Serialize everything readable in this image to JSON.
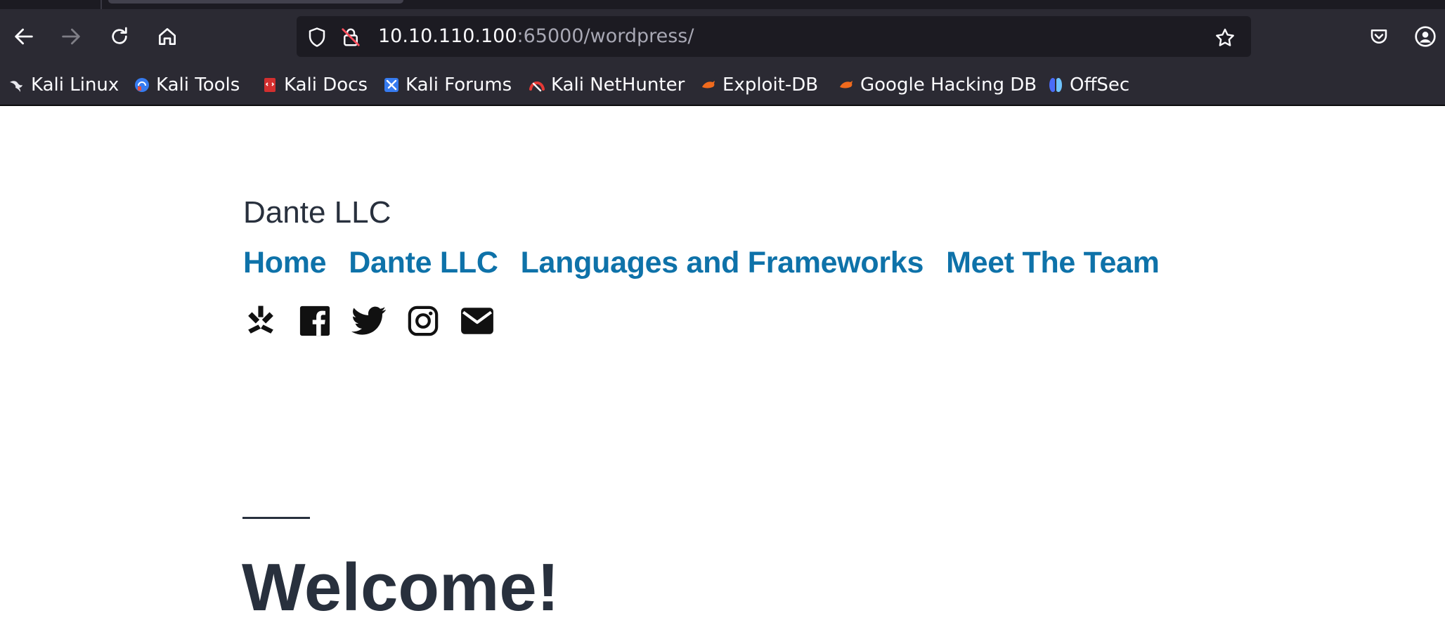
{
  "browser": {
    "url_host": "10.10.110.100",
    "url_rest": ":65000/wordpress/",
    "bookmarks": [
      {
        "label": "Kali Linux",
        "icon": "kali-dragon-icon"
      },
      {
        "label": "Kali Tools",
        "icon": "kali-tools-icon"
      },
      {
        "label": "Kali Docs",
        "icon": "kali-docs-icon"
      },
      {
        "label": "Kali Forums",
        "icon": "kali-forums-icon"
      },
      {
        "label": "Kali NetHunter",
        "icon": "kali-nethunter-icon"
      },
      {
        "label": "Exploit-DB",
        "icon": "exploit-db-icon"
      },
      {
        "label": "Google Hacking DB",
        "icon": "google-hacking-db-icon"
      },
      {
        "label": "OffSec",
        "icon": "offsec-icon"
      }
    ]
  },
  "site": {
    "title": "Dante LLC",
    "nav": [
      "Home",
      "Dante LLC",
      "Languages and Frameworks",
      "Meet The Team"
    ],
    "social_icons": [
      "yelp-icon",
      "facebook-icon",
      "twitter-icon",
      "instagram-icon",
      "mail-icon"
    ],
    "heading": "Welcome!"
  },
  "colors": {
    "link": "#0e72a9",
    "text": "#28303d",
    "toolbar": "#2b2a33"
  }
}
